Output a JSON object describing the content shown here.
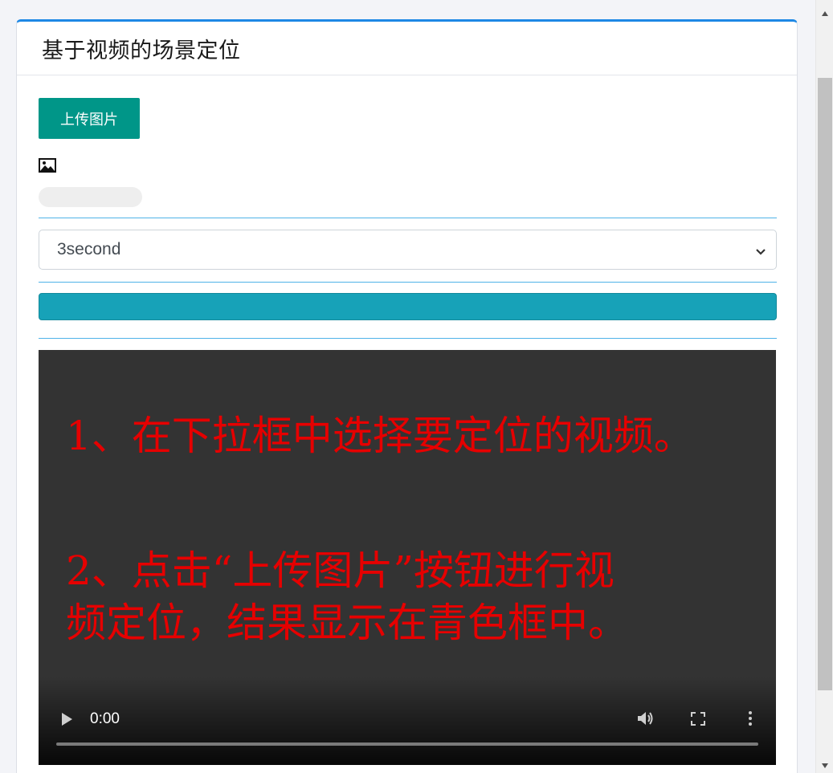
{
  "header": {
    "title": "基于视频的场景定位"
  },
  "upload": {
    "label": "上传图片"
  },
  "video_select": {
    "selected": "3second"
  },
  "video": {
    "overlay_line1": "1、在下拉框中选择要定位的视频。",
    "overlay_line2": "2、点击“上传图片”按钮进行视",
    "overlay_line3": "频定位，结果显示在青色框中。",
    "overlay_color": "#e60000",
    "time": "0:00"
  },
  "colors": {
    "card_accent": "#1e88e5",
    "upload_button": "#009688",
    "result_bar": "#17a2b8",
    "divider": "#4fb3e8"
  },
  "icons": {
    "image": "image-icon",
    "select": "chevron-down-icon",
    "play": "play-icon",
    "volume": "volume-icon",
    "fullscreen": "fullscreen-icon",
    "more": "more-vertical-icon"
  }
}
